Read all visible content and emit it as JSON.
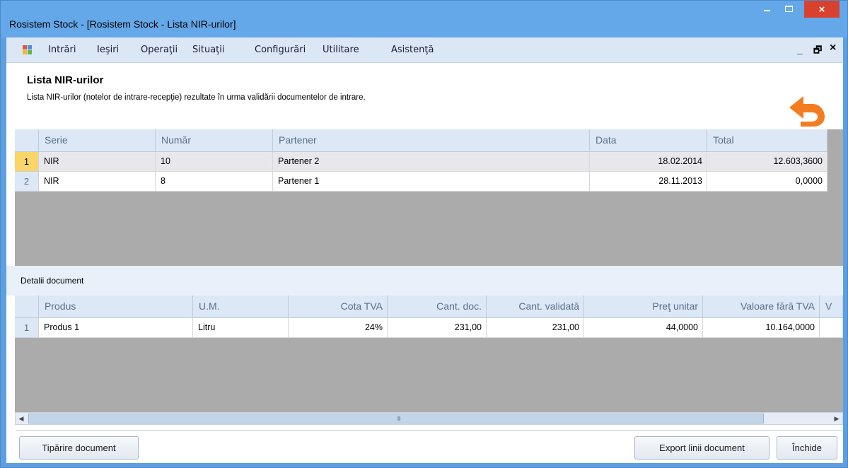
{
  "window": {
    "title": "Rosistem Stock - [Rosistem Stock - Lista NIR-urilor]",
    "close_glyph": "×"
  },
  "menu": {
    "items": [
      "Intrări",
      "Ieşiri",
      "Operaţii",
      "Situaţii",
      "Configurări",
      "Utilitare",
      "Asistenţă"
    ],
    "mdi_min": "_",
    "mdi_restore": "🗗",
    "mdi_close": "×"
  },
  "header": {
    "title": "Lista NIR-urilor",
    "description": "Lista NIR-urilor (notelor de intrare-recepţie) rezultate în urma validării documentelor de intrare.",
    "back_icon": "undo-arrow-icon"
  },
  "nir_grid": {
    "columns": [
      "Serie",
      "Număr",
      "Partener",
      "Data",
      "Total"
    ],
    "rows": [
      {
        "index": "1",
        "serie": "NIR",
        "numar": "10",
        "partener": "Partener 2",
        "data": "18.02.2014",
        "total": "12.603,3600"
      },
      {
        "index": "2",
        "serie": "NIR",
        "numar": "8",
        "partener": "Partener 1",
        "data": "28.11.2013",
        "total": "0,0000"
      }
    ]
  },
  "details": {
    "label": "Detalii document",
    "columns": [
      "Produs",
      "U.M.",
      "Cota TVA",
      "Cant. doc.",
      "Cant. validată",
      "Preţ unitar",
      "Valoare fără TVA",
      "V"
    ],
    "rows": [
      {
        "index": "1",
        "produs": "Produs 1",
        "um": "Litru",
        "cota_tva": "24%",
        "cant_doc": "231,00",
        "cant_validata": "231,00",
        "pret_unitar": "44,0000",
        "valoare": "10.164,0000",
        "v": ""
      }
    ]
  },
  "scrollbar": {
    "left_arrow": "◀",
    "right_arrow": "▶",
    "grip": "IIII"
  },
  "buttons": {
    "print": "Tipărire document",
    "export": "Export linii document",
    "close": "Închide"
  },
  "colors": {
    "titlebar": "#65a8ea",
    "close_button": "#d9412f",
    "selected_row_header": "#fad668",
    "back_icon": "#f47c20"
  }
}
